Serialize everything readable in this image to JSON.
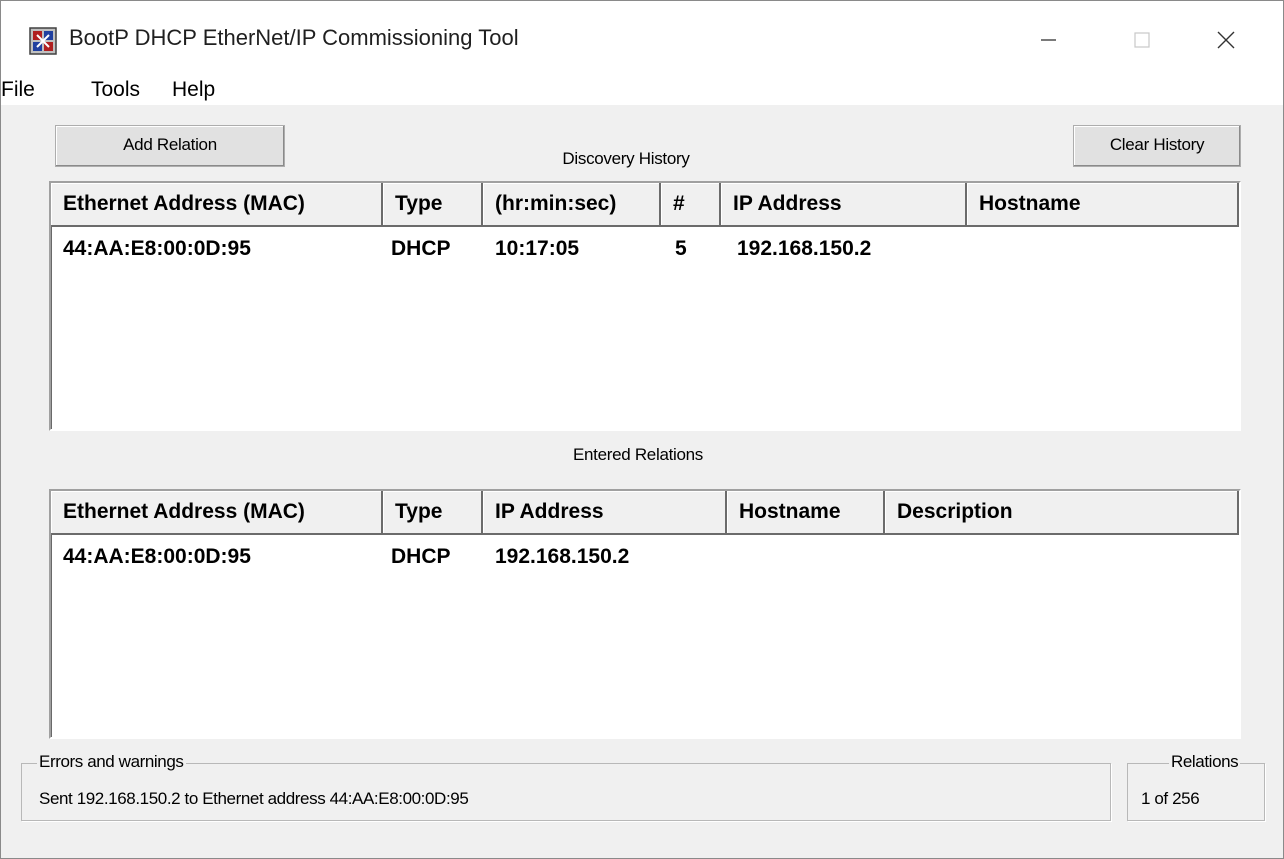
{
  "window": {
    "title": "BootP DHCP EtherNet/IP Commissioning Tool"
  },
  "menu": {
    "file": "File",
    "tools": "Tools",
    "help": "Help"
  },
  "buttons": {
    "add_relation": "Add Relation",
    "clear_history": "Clear History"
  },
  "discovery": {
    "caption": "Discovery History",
    "columns": [
      "Ethernet Address (MAC)",
      "Type",
      "(hr:min:sec)",
      "#",
      "IP Address",
      "Hostname"
    ],
    "rows": [
      {
        "mac": "44:AA:E8:00:0D:95",
        "type": "DHCP",
        "time": "10:17:05",
        "count": "5",
        "ip": "192.168.150.2",
        "hostname": ""
      }
    ]
  },
  "relations": {
    "caption": "Entered Relations",
    "columns": [
      "Ethernet Address (MAC)",
      "Type",
      "IP Address",
      "Hostname",
      "Description"
    ],
    "rows": [
      {
        "mac": "44:AA:E8:00:0D:95",
        "type": "DHCP",
        "ip": "192.168.150.2",
        "hostname": "",
        "description": ""
      }
    ]
  },
  "status": {
    "errors_label": "Errors and warnings",
    "errors_text": "Sent 192.168.150.2 to Ethernet address 44:AA:E8:00:0D:95",
    "relations_label": "Relations",
    "relations_count": "1 of 256"
  },
  "icons": {
    "app": "network-tool-icon",
    "minimize": "minimize-icon",
    "maximize": "maximize-icon",
    "close": "close-icon"
  }
}
